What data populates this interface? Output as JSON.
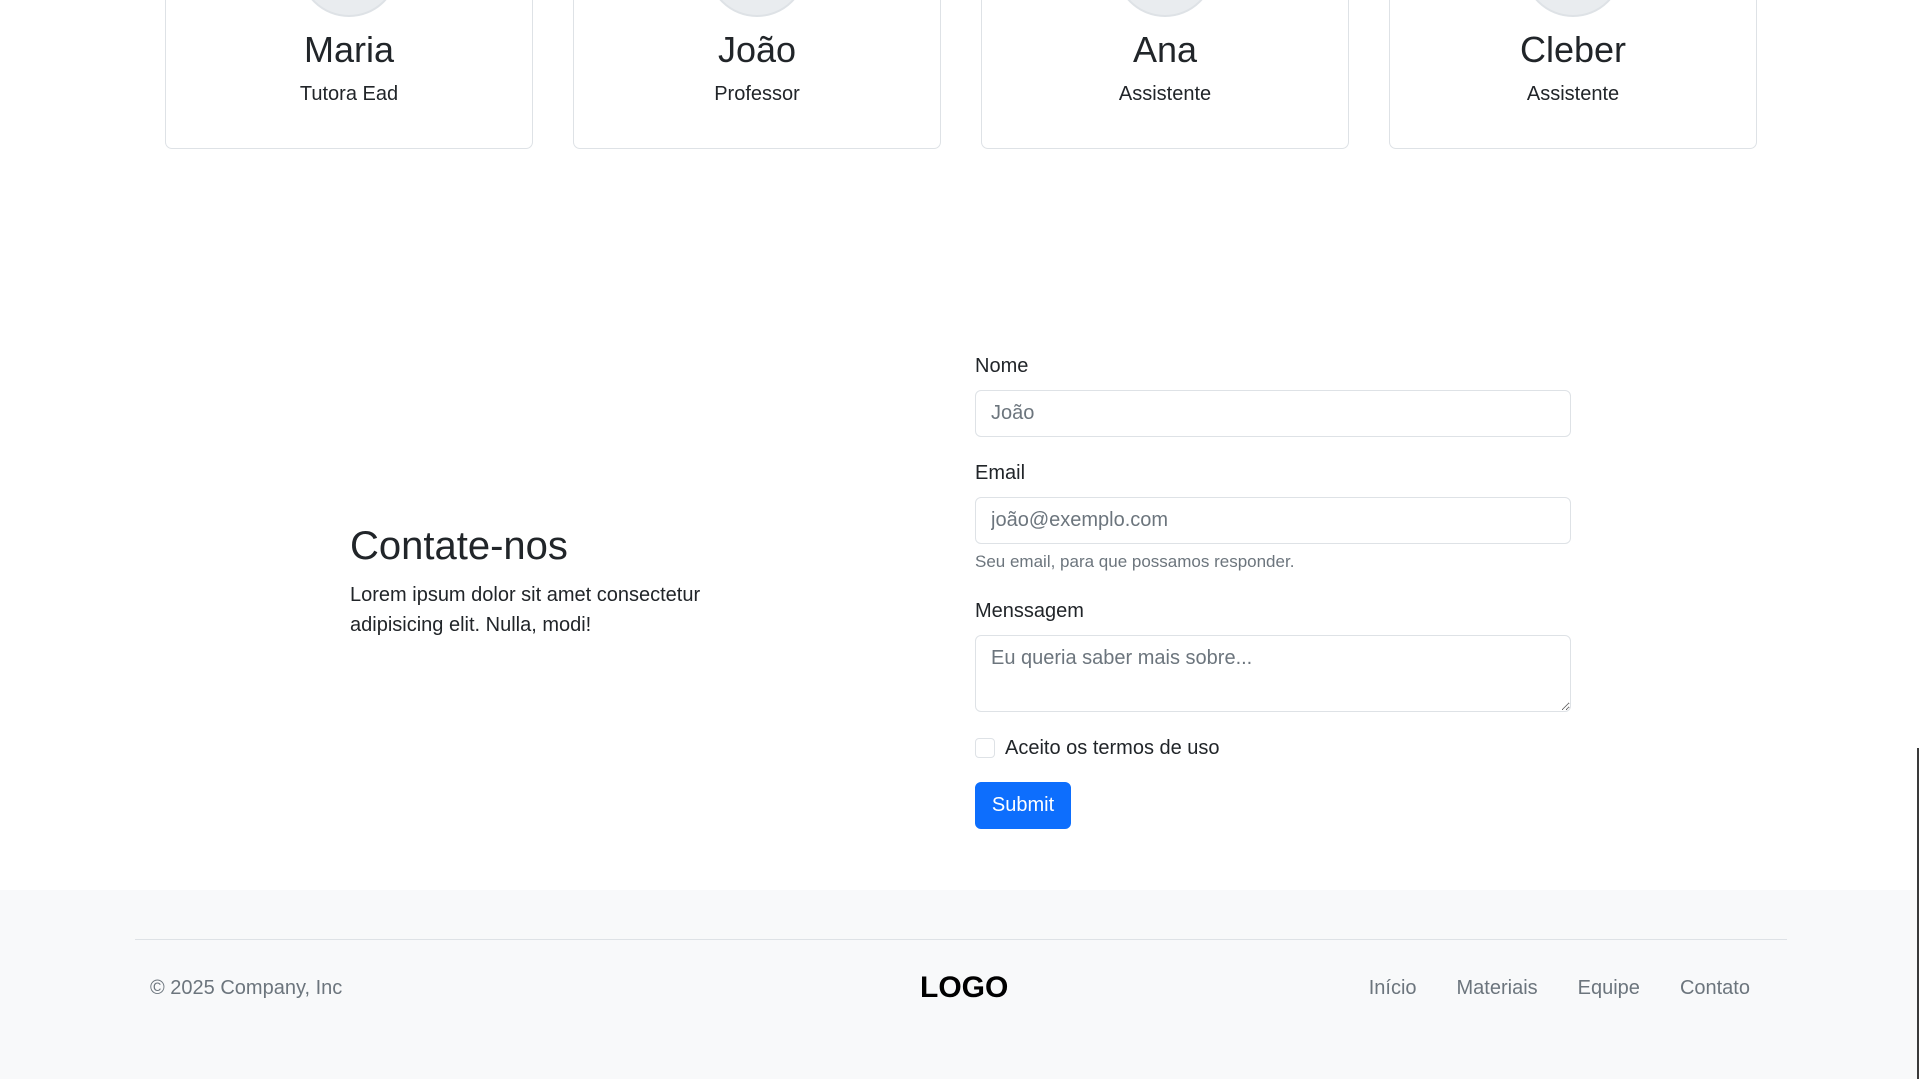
{
  "team": {
    "members": [
      {
        "name": "Maria",
        "role": "Tutora Ead"
      },
      {
        "name": "João",
        "role": "Professor"
      },
      {
        "name": "Ana",
        "role": "Assistente"
      },
      {
        "name": "Cleber",
        "role": "Assistente"
      }
    ]
  },
  "contact": {
    "heading": "Contate-nos",
    "text": "Lorem ipsum dolor sit amet consectetur adipisicing elit. Nulla, modi!"
  },
  "form": {
    "name_label": "Nome",
    "name_placeholder": "João",
    "email_label": "Email",
    "email_placeholder": "joão@exemplo.com",
    "email_help": "Seu email, para que possamos responder.",
    "message_label": "Menssagem",
    "message_placeholder": "Eu queria saber mais sobre...",
    "terms_label": "Aceito os termos de uso",
    "terms_checked": false,
    "submit_label": "Submit"
  },
  "footer": {
    "copyright": "© 2025 Company, Inc",
    "logo": "LOGO",
    "nav": [
      "Início",
      "Materiais",
      "Equipe",
      "Contato"
    ]
  },
  "colors": {
    "primary": "#0d6efd",
    "footer_bg": "#f8f9fa",
    "muted_text": "#6c757d",
    "border": "#dee2e6"
  }
}
